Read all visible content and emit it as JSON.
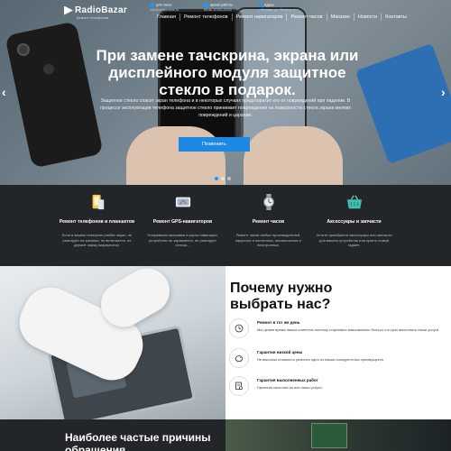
{
  "header": {
    "logo_text": "RadioBazar",
    "logo_subtitle": "ремонт телефонов",
    "contacts": [
      {
        "label": "для связи",
        "value": "info@radiobazar.ru"
      },
      {
        "label": "время работы",
        "value": "пн-вс 10:00-20:00"
      },
      {
        "label": "Адрес",
        "value": "г. Москва, ул. Ленина, 1"
      }
    ],
    "nav": [
      "Главная",
      "Ремонт телефонов",
      "Ремонт навигаторов",
      "Ремонт часов",
      "Магазин",
      "Новости",
      "Контакты"
    ]
  },
  "hero": {
    "title": "При замене тачскрина, экрана или дисплейного модуля защитное стекло в подарок.",
    "text": "Защитное стекло спасет экран телефона и в некоторых случаях предотвратит его от повреждений при падении. В процессе эксплуатации телефона защитное стекло принимает повреждения на поверхности стекла экрана мелких повреждений и царапин.",
    "button": "Позвонить",
    "slides": 3,
    "active_slide": 1
  },
  "services": [
    {
      "title": "Ремонт телефонов и планшетов",
      "text": "Если в вашем телефоне разбит экран, не реагирует на касания, не включается, не держит заряд аккумулятор.",
      "icon": "phone-tablet-icon"
    },
    {
      "title": "Ремонт GPS-навигаторов",
      "text": "Устаревшая прошивка и карты навигации, устройство не заряжается, не реагирует сенсор...",
      "icon": "gps-navigator-icon"
    },
    {
      "title": "Ремонт часов",
      "text": "Ремонт часов любых производителей, наручных и настенных, механических и электронных.",
      "icon": "watch-icon"
    },
    {
      "title": "Аксессуары и запчасти",
      "text": "Хотите приобрести аксессуары или запчасти для вашего устройства или купить новый гаджет.",
      "icon": "shopping-basket-icon"
    }
  ],
  "why": {
    "title": "Почему нужно выбрать нас?",
    "items": [
      {
        "title": "Ремонт в тот же день",
        "text": "Мы ценим время наших клиентов поэтому стараемся максимально быстро и в срок выполнить наши услуги.",
        "icon": "clock-icon"
      },
      {
        "title": "Гарантия низкой цены",
        "text": "Не высокая стоимость ремонта одно из наших конкурентных преимуществ.",
        "icon": "piggy-bank-icon"
      },
      {
        "title": "Гарантия выполненных работ",
        "text": "Гарантия качества на все наши услуги.",
        "icon": "certificate-icon"
      }
    ]
  },
  "faq": {
    "title": "Наиболее частые причины обращения"
  },
  "colors": {
    "accent": "#1e88e5",
    "dark": "#232629"
  }
}
